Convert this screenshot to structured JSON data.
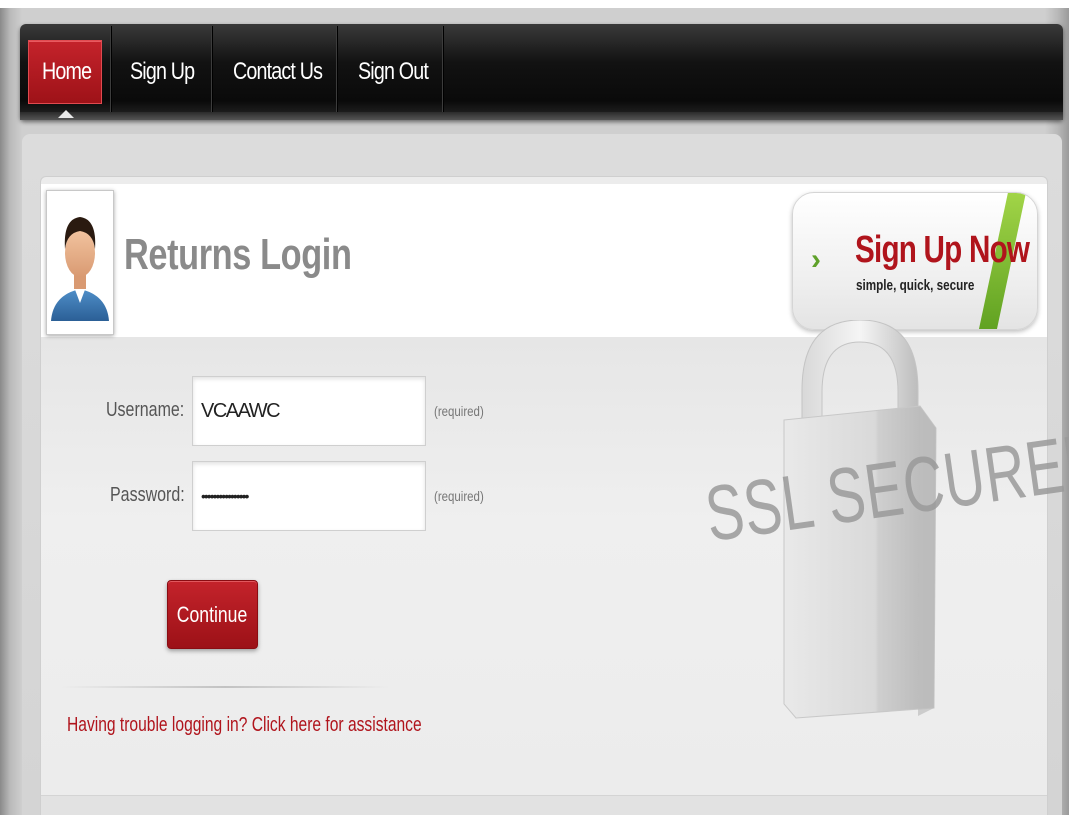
{
  "nav": {
    "items": [
      {
        "label": "Home",
        "active": true
      },
      {
        "label": "Sign Up",
        "active": false
      },
      {
        "label": "Contact Us",
        "active": false
      },
      {
        "label": "Sign Out",
        "active": false
      }
    ]
  },
  "header": {
    "title": "Returns Login",
    "avatar_icon": "user-avatar-icon"
  },
  "signup_promo": {
    "title": "Sign Up Now",
    "subtitle": "simple, quick, secure",
    "chevron_icon": "chevron-right-icon"
  },
  "form": {
    "username_label": "Username:",
    "username_value": "VCAAWC",
    "password_label": "Password:",
    "password_value": "••••••••••••••••",
    "required_text": "(required)",
    "submit_label": "Continue"
  },
  "help": {
    "link_text": "Having trouble logging in?  Click here for assistance"
  },
  "badge": {
    "ssl_text": "SSL SECURED",
    "lock_icon": "padlock-icon"
  },
  "colors": {
    "brand_red": "#b0141c",
    "navbar_bg": "#121212",
    "accent_green": "#5fa12a"
  }
}
